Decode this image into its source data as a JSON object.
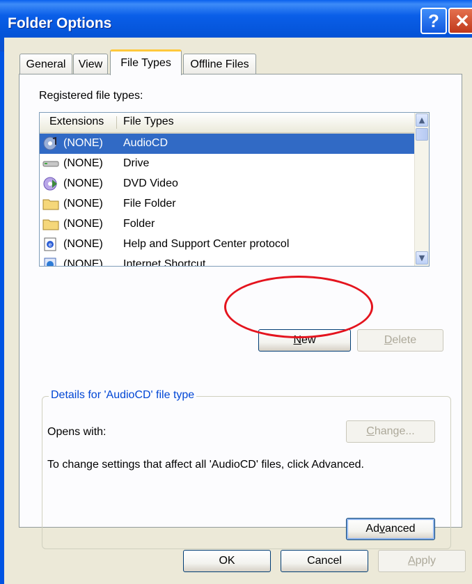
{
  "window": {
    "title": "Folder Options",
    "help_glyph": "?",
    "close_glyph": "✕"
  },
  "tabs": [
    {
      "label": "General"
    },
    {
      "label": "View"
    },
    {
      "label": "File Types",
      "active": true
    },
    {
      "label": "Offline Files"
    }
  ],
  "file_types": {
    "registered_label": "Registered file types:",
    "columns": {
      "extensions": "Extensions",
      "file_types": "File Types"
    },
    "rows": [
      {
        "ext": "(NONE)",
        "type": "AudioCD",
        "icon": "audio-cd-icon",
        "selected": true
      },
      {
        "ext": "(NONE)",
        "type": "Drive",
        "icon": "drive-icon"
      },
      {
        "ext": "(NONE)",
        "type": "DVD Video",
        "icon": "dvd-icon"
      },
      {
        "ext": "(NONE)",
        "type": "File Folder",
        "icon": "folder-icon"
      },
      {
        "ext": "(NONE)",
        "type": "Folder",
        "icon": "folder-icon"
      },
      {
        "ext": "(NONE)",
        "type": "Help and Support Center protocol",
        "icon": "help-document-icon"
      },
      {
        "ext": "(NONE)",
        "type": "Internet Shortcut",
        "icon": "internet-shortcut-icon"
      }
    ],
    "new_button": {
      "prefix": "",
      "accel": "N",
      "suffix": "ew"
    },
    "delete_button": {
      "prefix": "",
      "accel": "D",
      "suffix": "elete"
    }
  },
  "details": {
    "legend": "Details for 'AudioCD' file type",
    "opens_with_label": "Opens with:",
    "change_button": {
      "prefix": "",
      "accel": "C",
      "suffix": "hange..."
    },
    "description": "To change settings that affect all 'AudioCD' files, click Advanced.",
    "advanced_button": {
      "prefix": "Ad",
      "accel": "v",
      "suffix": "anced"
    }
  },
  "footer": {
    "ok": "OK",
    "cancel": "Cancel",
    "apply": {
      "prefix": "",
      "accel": "A",
      "suffix": "pply"
    }
  },
  "colors": {
    "selection": "#316ac5",
    "dialog_face": "#ece9d8",
    "annotation_ellipse": "#e4141e",
    "group_legend": "#0046d5"
  }
}
